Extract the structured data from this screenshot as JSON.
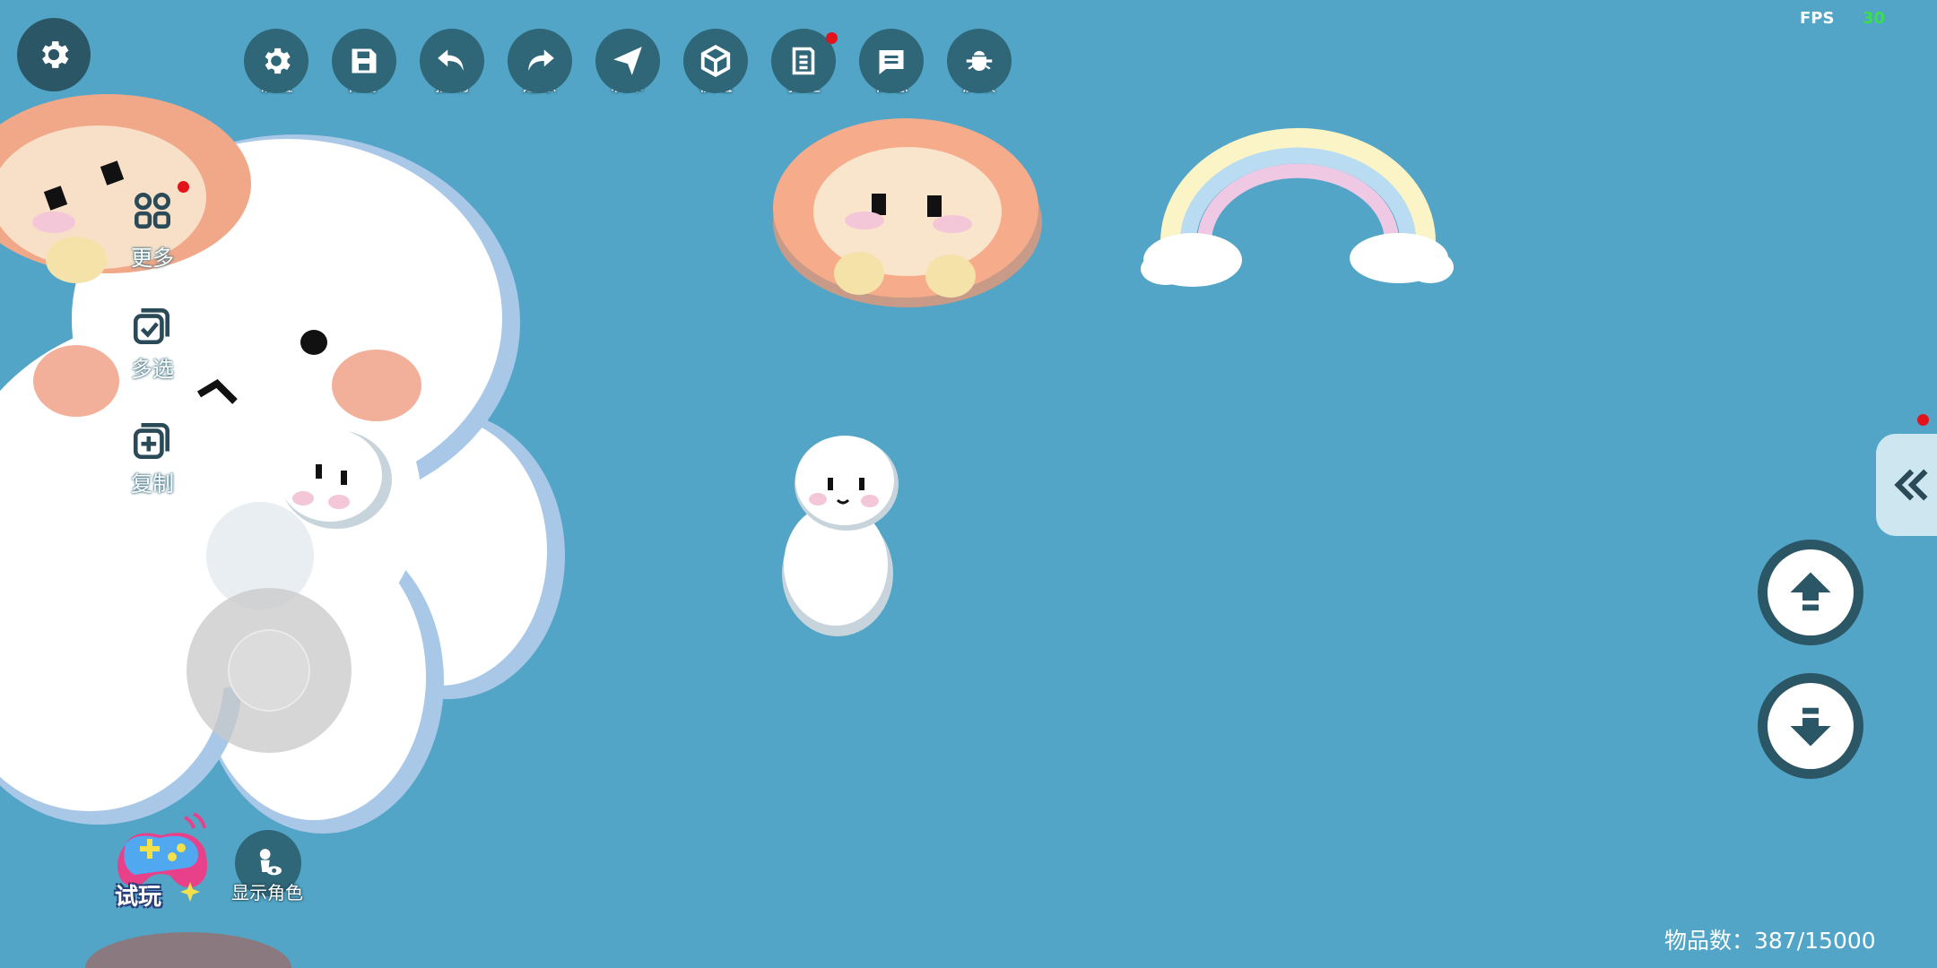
{
  "toolbar": {
    "items": [
      {
        "label": "设置",
        "icon": "settings-icon"
      },
      {
        "label": "保存",
        "icon": "save-icon"
      },
      {
        "label": "撤销",
        "icon": "undo-icon"
      },
      {
        "label": "还原",
        "icon": "redo-icon"
      },
      {
        "label": "发布",
        "icon": "publish-icon"
      },
      {
        "label": "模组",
        "icon": "module-icon"
      },
      {
        "label": "教程",
        "icon": "tutorial-icon"
      },
      {
        "label": "日志",
        "icon": "log-icon"
      },
      {
        "label": "反馈",
        "icon": "feedback-bug-icon"
      }
    ]
  },
  "fps": {
    "label": "FPS",
    "value": "30"
  },
  "side_panel": {
    "more": "更多",
    "multi_select": "多选",
    "copy": "复制"
  },
  "bottom": {
    "play": "试玩",
    "show_role": "显示角色"
  },
  "status": {
    "item_count": "物品数：387/15000"
  },
  "colors": {
    "background": "#52a5c6",
    "button_dark": "#2b5666",
    "notification": "#e3131b",
    "fps_value": "#3adf4a"
  }
}
